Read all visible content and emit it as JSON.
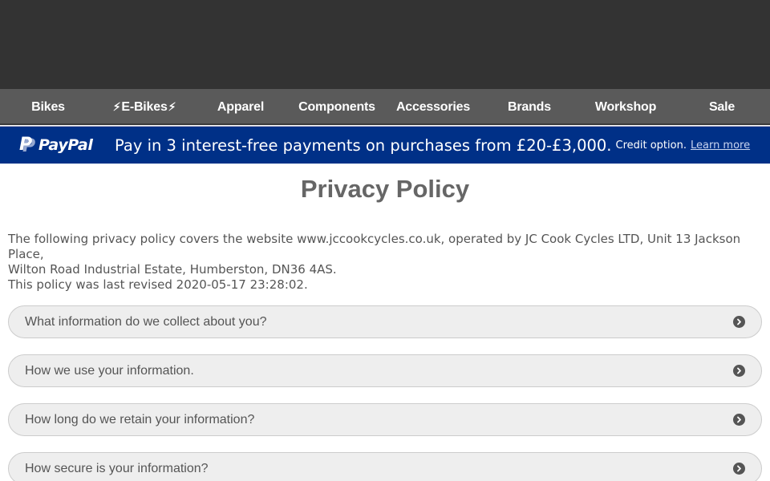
{
  "nav": {
    "items": [
      {
        "label": "Bikes"
      },
      {
        "label": "E-Bikes"
      },
      {
        "label": "Apparel"
      },
      {
        "label": "Components"
      },
      {
        "label": "Accessories"
      },
      {
        "label": "Brands"
      },
      {
        "label": "Workshop"
      },
      {
        "label": "Sale"
      }
    ],
    "ebike_icon": "lightning-bolt-icon"
  },
  "paypal_banner": {
    "logo_text": "PayPal",
    "message": "Pay in 3 interest-free payments on purchases from £20-£3,000.",
    "credit_text": "Credit option.",
    "link_text": "Learn more",
    "colors": {
      "background": "#003087"
    }
  },
  "page": {
    "title": "Privacy Policy",
    "intro_line1": "The following privacy policy covers the website www.jccookcycles.co.uk, operated by JC Cook Cycles LTD, Unit 13 Jackson Place,",
    "intro_line2": "Wilton Road Industrial Estate, Humberston, DN36 4AS.",
    "revised": "This policy was last revised 2020-05-17 23:28:02."
  },
  "accordion": {
    "items": [
      {
        "label": "What information do we collect about you?",
        "icon": "chevron-right-circle-icon"
      },
      {
        "label": "How we use your information.",
        "icon": "chevron-right-circle-icon"
      },
      {
        "label": "How long do we retain your information?",
        "icon": "chevron-right-circle-icon"
      },
      {
        "label": "How secure is your information?",
        "icon": "chevron-right-circle-icon"
      }
    ]
  }
}
